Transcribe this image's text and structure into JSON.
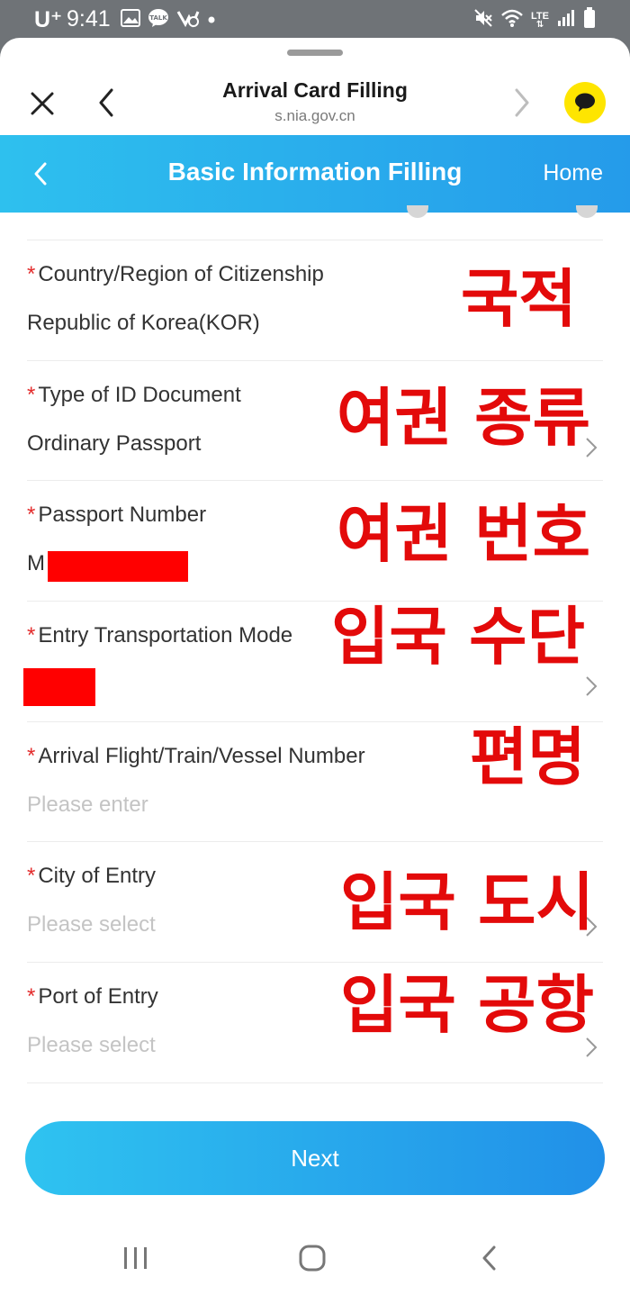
{
  "status_bar": {
    "carrier": "U⁺",
    "time": "9:41",
    "lte": "LTE",
    "left_icons": [
      "image-icon",
      "talk-icon",
      "mail-icon",
      "dot-icon"
    ],
    "right_icons": [
      "mute-icon",
      "wifi-icon",
      "lte-icon",
      "signal-icon",
      "battery-icon"
    ]
  },
  "browser": {
    "title": "Arrival Card Filling",
    "url": "s.nia.gov.cn"
  },
  "header": {
    "title": "Basic Information Filling",
    "home_label": "Home"
  },
  "form": {
    "required_mark": "*",
    "fields": [
      {
        "label": "Country/Region of Citizenship",
        "value": "Republic of Korea(KOR)",
        "annotation": "국적"
      },
      {
        "label": "Type of ID Document",
        "value": "Ordinary Passport",
        "annotation": "여권 종류"
      },
      {
        "label": "Passport Number",
        "value": "M",
        "annotation": "여권 번호"
      },
      {
        "label": "Entry Transportation Mode",
        "value": "",
        "annotation": "입국 수단"
      },
      {
        "label": "Arrival Flight/Train/Vessel Number",
        "placeholder": "Please enter",
        "annotation": "편명"
      },
      {
        "label": "City of Entry",
        "placeholder": "Please select",
        "annotation": "입국 도시"
      },
      {
        "label": "Port of Entry",
        "placeholder": "Please select",
        "annotation": "입국 공항"
      }
    ]
  },
  "next_button": "Next",
  "colors": {
    "header_gradient_start": "#2ec0ee",
    "header_gradient_end": "#259bea",
    "required_star": "#e32c2c",
    "annotation_red": "#e30a0a",
    "redaction": "#ff0000",
    "kakao_yellow": "#fee500"
  }
}
